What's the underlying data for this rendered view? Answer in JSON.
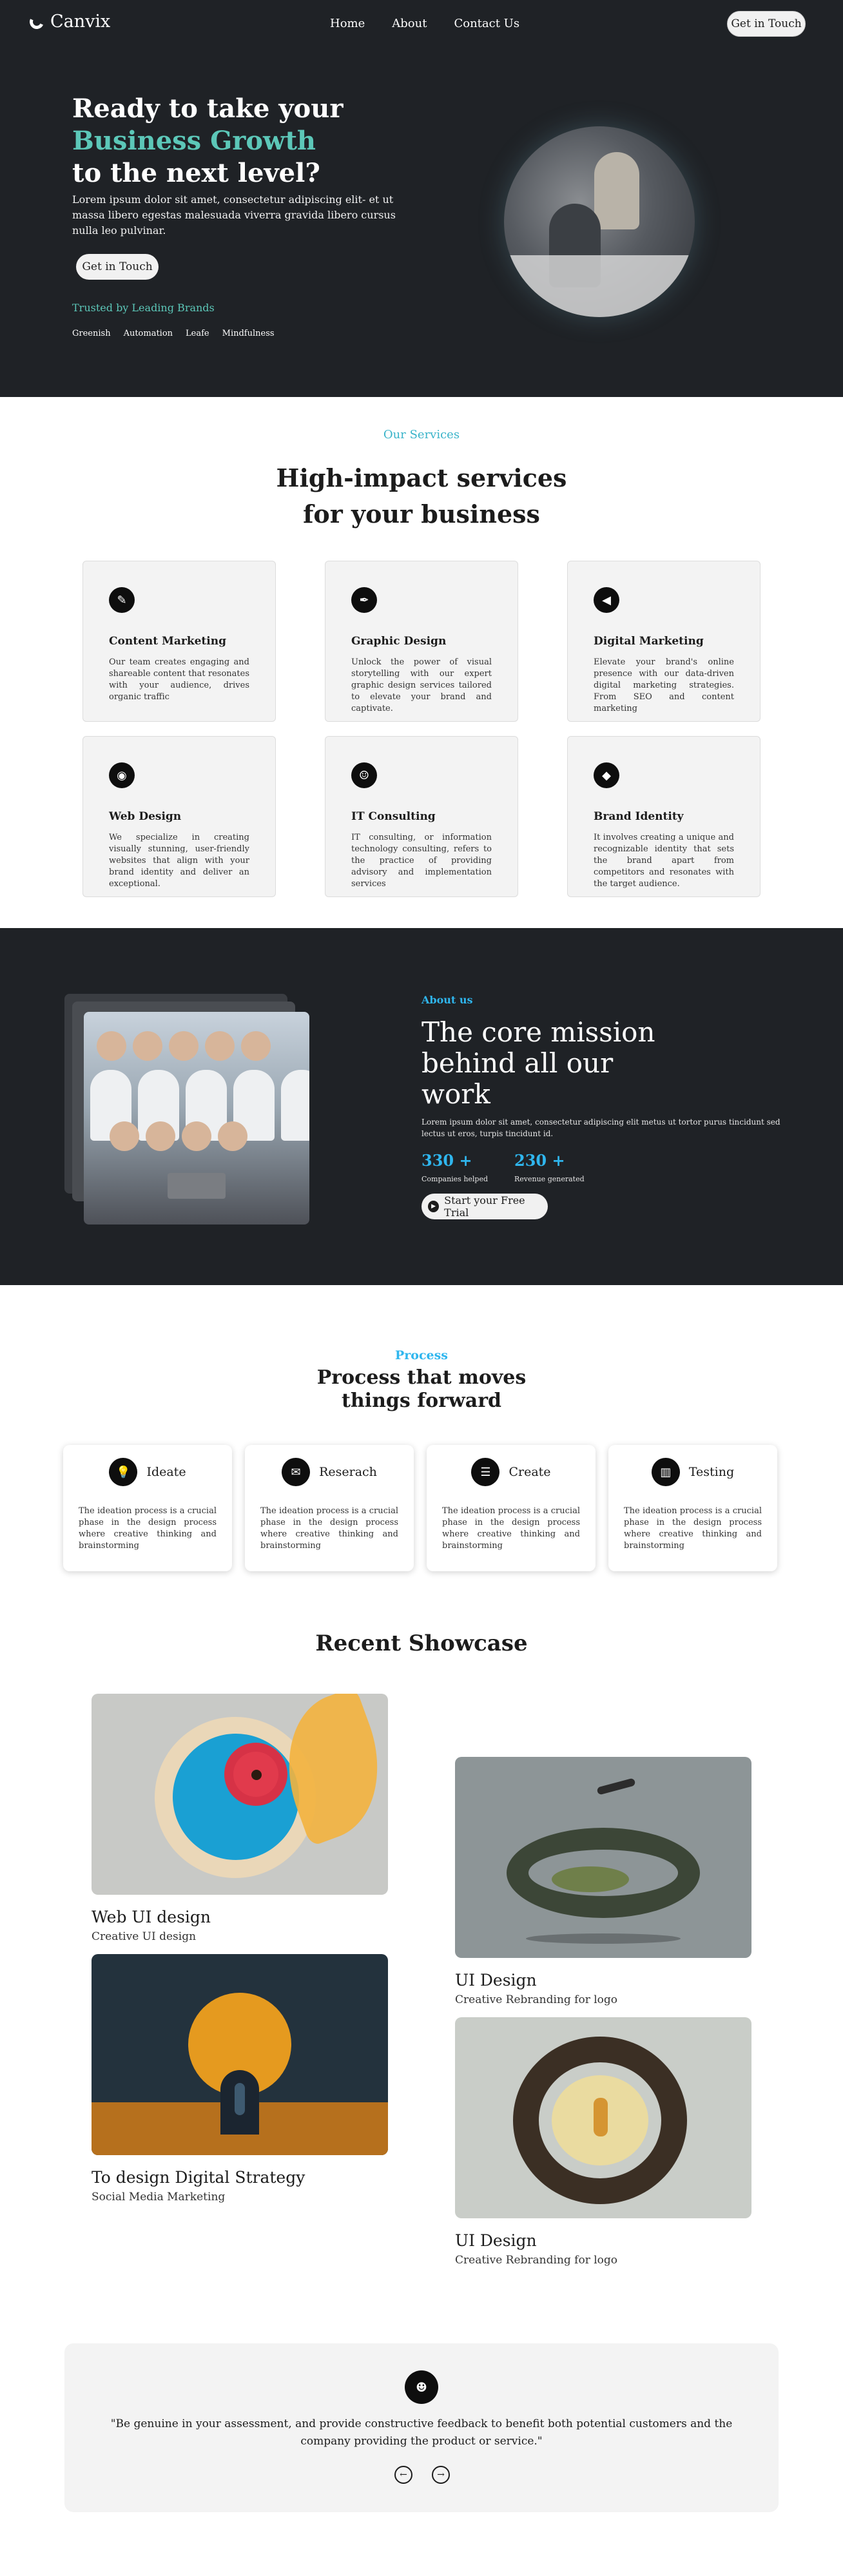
{
  "nav": {
    "brand": "Canvix",
    "links": [
      "Home",
      "About",
      "Contact Us"
    ],
    "cta": "Get in Touch"
  },
  "hero": {
    "title_line1": "Ready to take your",
    "title_accent": "Business Growth",
    "title_line3": "to the next level?",
    "lead": "Lorem ipsum dolor sit amet, consectetur adipiscing elit- et ut massa libero egestas malesuada viverra gravida libero cursus nulla leo pulvinar.",
    "cta": "Get in Touch",
    "trusted": "Trusted by Leading Brands",
    "brands": [
      "Greenish",
      "Automation",
      "Leafe",
      "Mindfulness"
    ],
    "accent_color": "#5cc7b8"
  },
  "services": {
    "kicker": "Our Services",
    "title_line1": "High-impact services",
    "title_line2": "for your business",
    "items": [
      {
        "icon": "pencil-icon",
        "title": "Content Marketing",
        "text": "Our team creates engaging and shareable content that resonates with your audience, drives organic traffic"
      },
      {
        "icon": "pen-nib-icon",
        "title": "Graphic Design",
        "text": "Unlock the power of visual storytelling with our expert graphic design services tailored to elevate your brand and captivate."
      },
      {
        "icon": "megaphone-icon",
        "title": "Digital Marketing",
        "text": "Elevate your brand's online presence with our data-driven digital marketing strategies. From SEO and content marketing"
      },
      {
        "icon": "palette-icon",
        "title": "Web Design",
        "text": "We specialize in creating visually stunning, user-friendly websites that align with your brand identity and deliver an exceptional."
      },
      {
        "icon": "user-gear-icon",
        "title": "IT Consulting",
        "text": "IT consulting, or information technology consulting, refers to the practice of providing advisory and implementation services"
      },
      {
        "icon": "gem-icon",
        "title": "Brand Identity",
        "text": "It involves creating a unique and recognizable identity that sets the brand apart from competitors and resonates with the target audience."
      }
    ]
  },
  "about": {
    "kicker": "About us",
    "title": "The core mission behind all our work",
    "desc": "Lorem ipsum dolor sit amet, consectetur adipiscing elit metus ut tortor purus tincidunt sed lectus ut eros, turpis tincidunt id.",
    "stats": [
      {
        "value": "330 +",
        "label": "Companies helped"
      },
      {
        "value": "230 +",
        "label": "Revenue generated"
      }
    ],
    "cta": "Start your Free Trial",
    "accent_color": "#2fb6ee"
  },
  "process": {
    "kicker": "Process",
    "title_line1": "Process that moves",
    "title_line2": "things forward",
    "steps": [
      {
        "icon": "lightbulb-icon",
        "title": "Ideate",
        "text": "The ideation process is a crucial phase in the design process where creative thinking and brainstorming"
      },
      {
        "icon": "envelope-icon",
        "title": "Reserach",
        "text": "The ideation process is a crucial phase in the design process where creative thinking and brainstorming"
      },
      {
        "icon": "sliders-icon",
        "title": "Create",
        "text": "The ideation process is a crucial phase in the design process where creative thinking and brainstorming"
      },
      {
        "icon": "chart-icon",
        "title": "Testing",
        "text": "The ideation process is a crucial phase in the design process where creative thinking and brainstorming"
      }
    ]
  },
  "showcase": {
    "title": "Recent Showcase",
    "items": [
      {
        "name": "Web UI design",
        "sub": "Creative UI design"
      },
      {
        "name": "UI Design",
        "sub": "Creative Rebranding for logo"
      },
      {
        "name": "To design Digital Strategy",
        "sub": "Social Media Marketing"
      },
      {
        "name": "UI Design",
        "sub": "Creative Rebranding for logo"
      }
    ]
  },
  "testimonial": {
    "avatar_icon": "person-icon",
    "quote": "\"Be genuine in your assessment, and provide constructive feedback to benefit both potential customers and the company providing the product or service.\""
  }
}
